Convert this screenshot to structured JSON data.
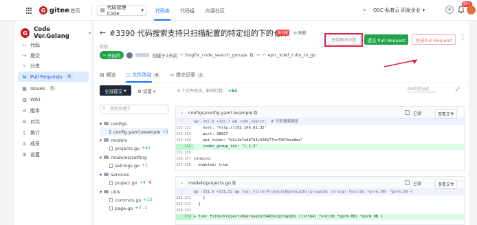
{
  "topbar": {
    "logo": "gitee",
    "home": "首页",
    "project_select": "代码管理 Code",
    "tabs": [
      "代码库",
      "代码组",
      "内源社区"
    ],
    "enterprise": "OSC-私有云 研发企业",
    "badge": "99+"
  },
  "sidebar": {
    "repo_name": "Code Ver.Golang",
    "items": [
      {
        "label": "代码",
        "icon": "code-icon"
      },
      {
        "label": "提交",
        "icon": "commit-icon"
      },
      {
        "label": "分支",
        "icon": "branch-icon"
      },
      {
        "label": "Pull Requests",
        "icon": "pr-icon",
        "count": "4",
        "active": true
      },
      {
        "label": "Issues",
        "icon": "issue-icon",
        "count": "3"
      },
      {
        "label": "Wiki",
        "icon": "wiki-icon"
      },
      {
        "label": "版本",
        "icon": "tag-icon"
      },
      {
        "label": "对比",
        "icon": "compare-icon"
      },
      {
        "label": "统计",
        "icon": "stats-icon"
      },
      {
        "label": "成员",
        "icon": "members-icon"
      },
      {
        "label": "设置",
        "icon": "settings-icon"
      }
    ]
  },
  "pr": {
    "title": "#3390 代码搜索支持只扫描配置的特定组的下的仓库",
    "tag": "新功能",
    "refresh": "刷新",
    "status_label": "状态",
    "status": "开启的",
    "meta_created": "创建于1天前",
    "source_branch": "bugfix_code_search_groups",
    "target_branch": "epic_kdef_ruby_to_go",
    "actions": {
      "resolve": "无待解决问题",
      "submit": "提交 Pull Request",
      "close": "关闭Pull Request"
    }
  },
  "tabs": [
    {
      "label": "概览"
    },
    {
      "label": "文件改动",
      "count": "6"
    },
    {
      "label": "提交记录",
      "count": "1"
    }
  ],
  "toolbar": {
    "all_commits": "全部提交",
    "settings": "设置",
    "summary": "6 个文件改动，影响行数：",
    "additions": "+64",
    "viewed": "0/6文件已读"
  },
  "tree": {
    "filter_placeholder": "搜索关键字",
    "items": [
      {
        "type": "folder",
        "name": "configs"
      },
      {
        "type": "file",
        "name": "config.yaml.example",
        "add": "+1"
      },
      {
        "type": "folder",
        "name": "models"
      },
      {
        "type": "file",
        "name": "projects.go",
        "add": "+42"
      },
      {
        "type": "folder",
        "name": "modules/setting"
      },
      {
        "type": "file",
        "name": "settings.go",
        "add": "+1"
      },
      {
        "type": "folder",
        "name": "services"
      },
      {
        "type": "file",
        "name": "project.go",
        "add": "+4",
        "del": "-6"
      },
      {
        "type": "folder",
        "name": "utils"
      },
      {
        "type": "file",
        "name": "common.go",
        "add": "+13"
      },
      {
        "type": "file",
        "name": "page.go",
        "add": "+3",
        "del": "-1"
      }
    ]
  },
  "diffs": [
    {
      "path": "configs/config.yaml.example",
      "viewed": "已读",
      "view_file": "查看文件",
      "lines": [
        {
          "type": "hunk",
          "a": "",
          "b": "",
          "code": "@@ -152,6 +152,7 @@ code_search:  # 代码搜索服务"
        },
        {
          "type": "ctx",
          "a": "152",
          "b": "152",
          "code": "    host: \"http://192.166.81.32\""
        },
        {
          "type": "ctx",
          "a": "153",
          "b": "153",
          "code": "    port: 38027"
        },
        {
          "type": "ctx",
          "a": "154",
          "b": "154",
          "code": "    api_token: \"b3c1b7ed8764c568177bc7807dea8ee\""
        },
        {
          "type": "add",
          "a": "",
          "b": "155",
          "code": "    index_group_ids: \"1,2,3\""
        },
        {
          "type": "ctx",
          "a": "155",
          "b": "156",
          "code": ""
        },
        {
          "type": "ctx",
          "a": "156",
          "b": "157",
          "code": "jenkins:"
        },
        {
          "type": "ctx",
          "a": "157",
          "b": "158",
          "code": "  enabled: true"
        }
      ]
    },
    {
      "path": "models/projects.go",
      "viewed": "已读",
      "view_file": "查看文件",
      "lines": [
        {
          "type": "hunk",
          "a": "",
          "b": "",
          "code": "@@ -331,6 +331,52 @@ func FilterProjectsByGroupIDs(groupIDs string) func(db *gorm.DB) *gorm.DB {"
        },
        {
          "type": "ctx",
          "a": "331",
          "b": "331",
          "code": "    }"
        },
        {
          "type": "ctx",
          "a": "332",
          "b": "332",
          "code": "  }"
        },
        {
          "type": "ctx",
          "a": "333",
          "b": "333",
          "code": ""
        },
        {
          "type": "add",
          "a": "",
          "b": "334",
          "code": "+ func FilterProjectsByGroupInt64IDs(groupIDs []int64) func(db *gorm.DB) *gorm.DB {"
        }
      ]
    }
  ],
  "colors": {
    "accent": "#1677ff",
    "success": "#22a34a",
    "danger": "#ef4444",
    "brand": "#c71d23"
  }
}
